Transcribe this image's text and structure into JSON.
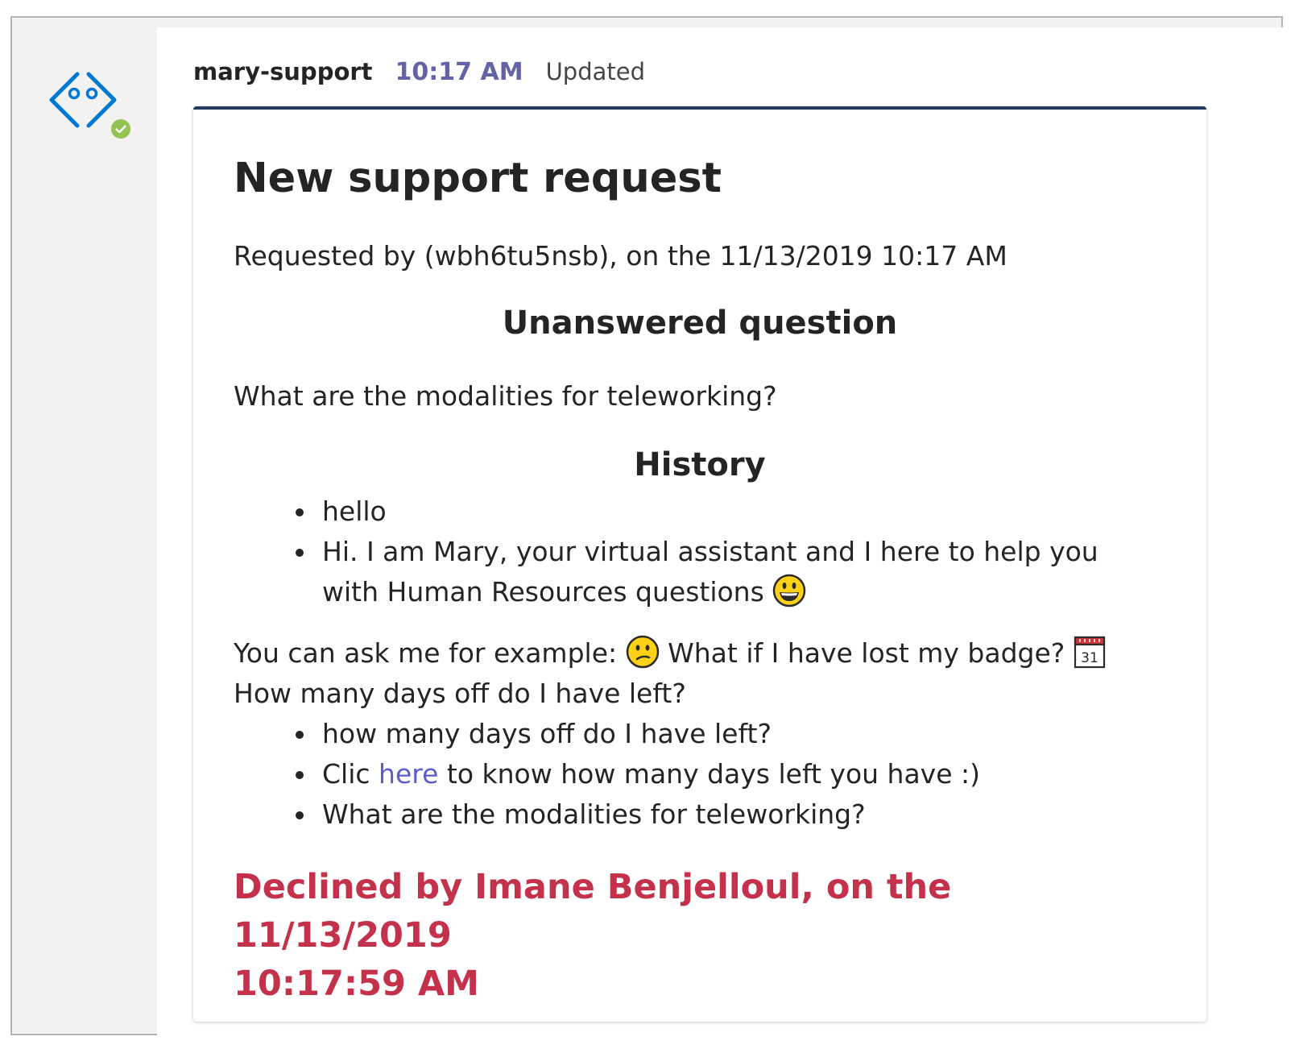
{
  "message": {
    "sender": "mary-support",
    "time": "10:17 AM",
    "status": "Updated"
  },
  "card": {
    "title": "New support request",
    "requested_by": "Requested by (wbh6tu5nsb), on the 11/13/2019 10:17 AM",
    "unanswered_heading": "Unanswered question",
    "question": "What are the modalities for teleworking?",
    "history_heading": "History",
    "history_items": [
      {
        "text": "hello"
      },
      {
        "text_line1": "Hi. I am Mary, your virtual assistant and I here to help you",
        "text_line2": "with Human Resources questions",
        "emoji": "grinning-face-icon"
      }
    ],
    "examples_intro": "You can ask me for example:",
    "examples_emoji1": "confused-face-icon",
    "examples_question": "What if I have lost my badge?",
    "examples_emoji2": "calendar-icon",
    "examples_calendar_day": "31",
    "examples_line2": "How many days off do I have left?",
    "example_items": [
      {
        "text": "how many days off do I have left?"
      },
      {
        "prefix": "Clic",
        "link": "here",
        "suffix": "to know how many days left you have :)"
      },
      {
        "text": "What are the modalities for teleworking?"
      }
    ],
    "declined_line1": "Declined by Imane Benjelloul, on the 11/13/2019",
    "declined_line2": "10:17:59 AM"
  },
  "colors": {
    "accent": "#6264a7",
    "link": "#5b5fc7",
    "declined": "#c4314b",
    "presence": "#92c353",
    "avatar": "#0078d4"
  }
}
